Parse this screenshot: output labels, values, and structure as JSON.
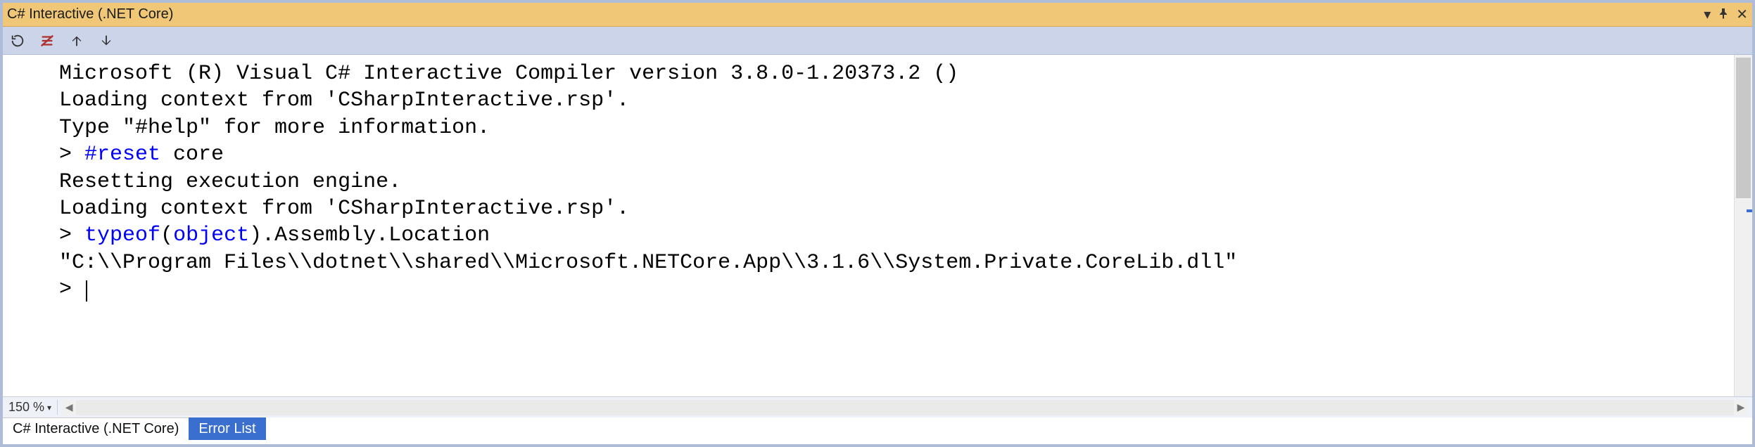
{
  "title": "C# Interactive (.NET Core)",
  "toolbar": {
    "reset": "reset-icon",
    "clear": "clear-icon",
    "up": "history-up-icon",
    "down": "history-down-icon"
  },
  "console": {
    "lines": [
      {
        "type": "text",
        "content": "Microsoft (R) Visual C# Interactive Compiler version 3.8.0-1.20373.2 ()"
      },
      {
        "type": "text",
        "content": "Loading context from 'CSharpInteractive.rsp'."
      },
      {
        "type": "text",
        "content": "Type \"#help\" for more information."
      },
      {
        "type": "prompt",
        "segments": [
          {
            "t": "> ",
            "c": "plain"
          },
          {
            "t": "#reset",
            "c": "kw-blue"
          },
          {
            "t": " core",
            "c": "plain"
          }
        ]
      },
      {
        "type": "text",
        "content": "Resetting execution engine."
      },
      {
        "type": "text",
        "content": "Loading context from 'CSharpInteractive.rsp'."
      },
      {
        "type": "prompt",
        "segments": [
          {
            "t": "> ",
            "c": "plain"
          },
          {
            "t": "typeof",
            "c": "kw-blue"
          },
          {
            "t": "(",
            "c": "plain"
          },
          {
            "t": "object",
            "c": "kw-blue"
          },
          {
            "t": ").Assembly.Location",
            "c": "plain"
          }
        ]
      },
      {
        "type": "text",
        "content": "\"C:\\\\Program Files\\\\dotnet\\\\shared\\\\Microsoft.NETCore.App\\\\3.1.6\\\\System.Private.CoreLib.dll\""
      },
      {
        "type": "prompt-cursor",
        "prefix": "> "
      }
    ]
  },
  "status": {
    "zoom": "150 %"
  },
  "tabs": [
    {
      "label": "C# Interactive (.NET Core)",
      "active": true
    },
    {
      "label": "Error List",
      "active": false
    }
  ]
}
